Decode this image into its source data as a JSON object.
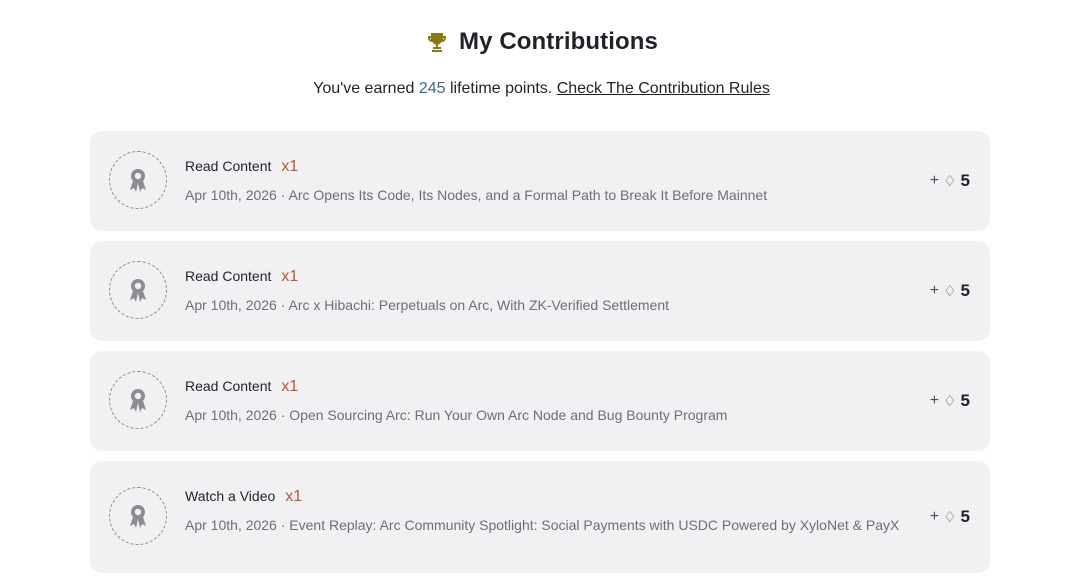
{
  "header": {
    "icon": "trophy-icon",
    "title": "My Contributions"
  },
  "summary": {
    "prefix": "You've earned",
    "points": "245",
    "suffix": "lifetime points.",
    "rules_link": "Check The Contribution Rules"
  },
  "colors": {
    "trophy": "#8a7a14",
    "points": "#3d6a8a",
    "multiplier": "#c0562a",
    "card_bg": "#f1f1f3"
  },
  "contributions": [
    {
      "action": "Read Content",
      "multiplier": "x1",
      "meta": "Apr 10th, 2026 · Arc Opens Its Code, Its Nodes, and a Formal Path to Break It Before Mainnet",
      "reward_prefix": "+",
      "reward_icon": "diamond-icon",
      "reward_value": "5"
    },
    {
      "action": "Read Content",
      "multiplier": "x1",
      "meta": "Apr 10th, 2026 · Arc x Hibachi: Perpetuals on Arc, With ZK-Verified Settlement",
      "reward_prefix": "+",
      "reward_icon": "diamond-icon",
      "reward_value": "5"
    },
    {
      "action": "Read Content",
      "multiplier": "x1",
      "meta": "Apr 10th, 2026 · Open Sourcing Arc: Run Your Own Arc Node and Bug Bounty Program",
      "reward_prefix": "+",
      "reward_icon": "diamond-icon",
      "reward_value": "5"
    },
    {
      "action": "Watch a Video",
      "multiplier": "x1",
      "meta": "Apr 10th, 2026 · Event Replay: Arc Community Spotlight: Social Payments with USDC Powered by XyloNet & PayX",
      "reward_prefix": "+",
      "reward_icon": "diamond-icon",
      "reward_value": "5"
    }
  ]
}
